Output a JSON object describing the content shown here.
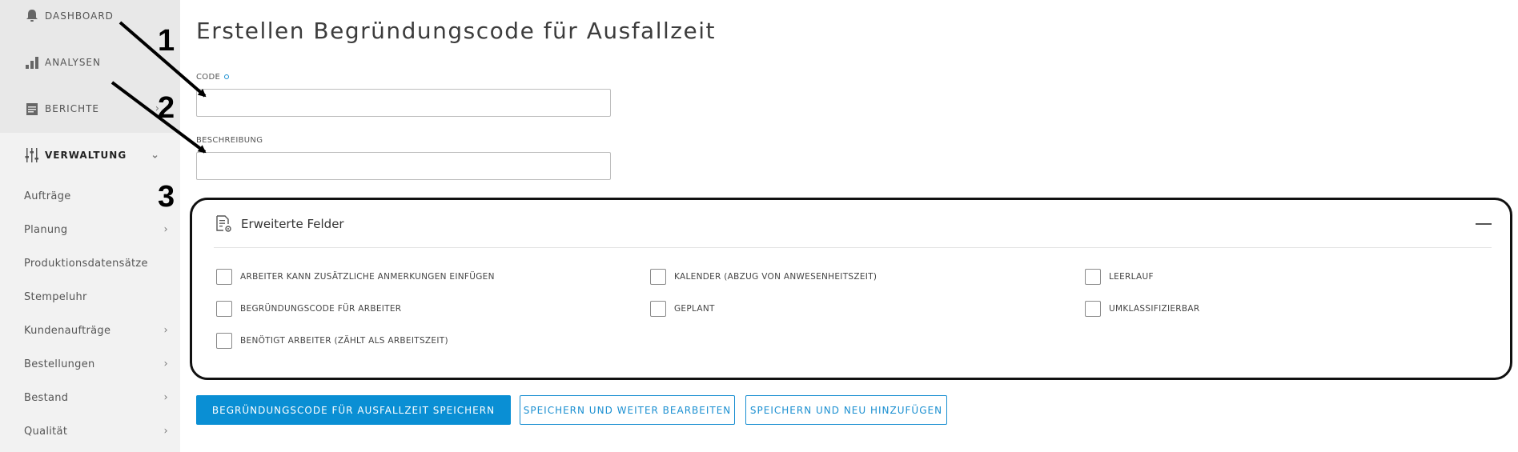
{
  "sidebar": {
    "main_items": [
      {
        "label": "DASHBOARD"
      },
      {
        "label": "ANALYSEN"
      },
      {
        "label": "BERICHTE"
      },
      {
        "label": "VERWALTUNG"
      }
    ],
    "sub_items": [
      {
        "label": "Aufträge"
      },
      {
        "label": "Planung"
      },
      {
        "label": "Produktionsdatensätze"
      },
      {
        "label": "Stempeluhr"
      },
      {
        "label": "Kundenaufträge"
      },
      {
        "label": "Bestellungen"
      },
      {
        "label": "Bestand"
      },
      {
        "label": "Qualität"
      }
    ]
  },
  "page": {
    "title": "Erstellen Begründungscode für Ausfallzeit"
  },
  "form": {
    "code_label": "CODE",
    "code_value": "",
    "description_label": "BESCHREIBUNG",
    "description_value": ""
  },
  "extended": {
    "title": "Erweiterte Felder",
    "checkboxes": [
      {
        "label": "ARBEITER KANN ZUSÄTZLICHE ANMERKUNGEN EINFÜGEN",
        "checked": false
      },
      {
        "label": "KALENDER (ABZUG VON ANWESENHEITSZEIT)",
        "checked": false
      },
      {
        "label": "LEERLAUF",
        "checked": false
      },
      {
        "label": "BEGRÜNDUNGSCODE FÜR ARBEITER",
        "checked": false
      },
      {
        "label": "GEPLANT",
        "checked": false
      },
      {
        "label": "UMKLASSIFIZIERBAR",
        "checked": false
      },
      {
        "label": "BENÖTIGT ARBEITER (ZÄHLT ALS ARBEITSZEIT)",
        "checked": false
      }
    ]
  },
  "actions": {
    "save": "BEGRÜNDUNGSCODE FÜR AUSFALLZEIT SPEICHERN",
    "save_continue": "SPEICHERN UND WEITER BEARBEITEN",
    "save_add": "SPEICHERN UND NEU HINZUFÜGEN"
  },
  "annotations": {
    "marker_1": "1",
    "marker_2": "2",
    "marker_3": "3"
  },
  "colors": {
    "accent": "#0a8fd4",
    "sidebar_bg": "#f2f2f2",
    "annotation": "#000000"
  },
  "icons": [
    "bell-icon",
    "bar-chart-icon",
    "report-icon",
    "sliders-icon",
    "chevron-right-icon",
    "chevron-down-icon",
    "settings-document-icon",
    "collapse-icon"
  ]
}
